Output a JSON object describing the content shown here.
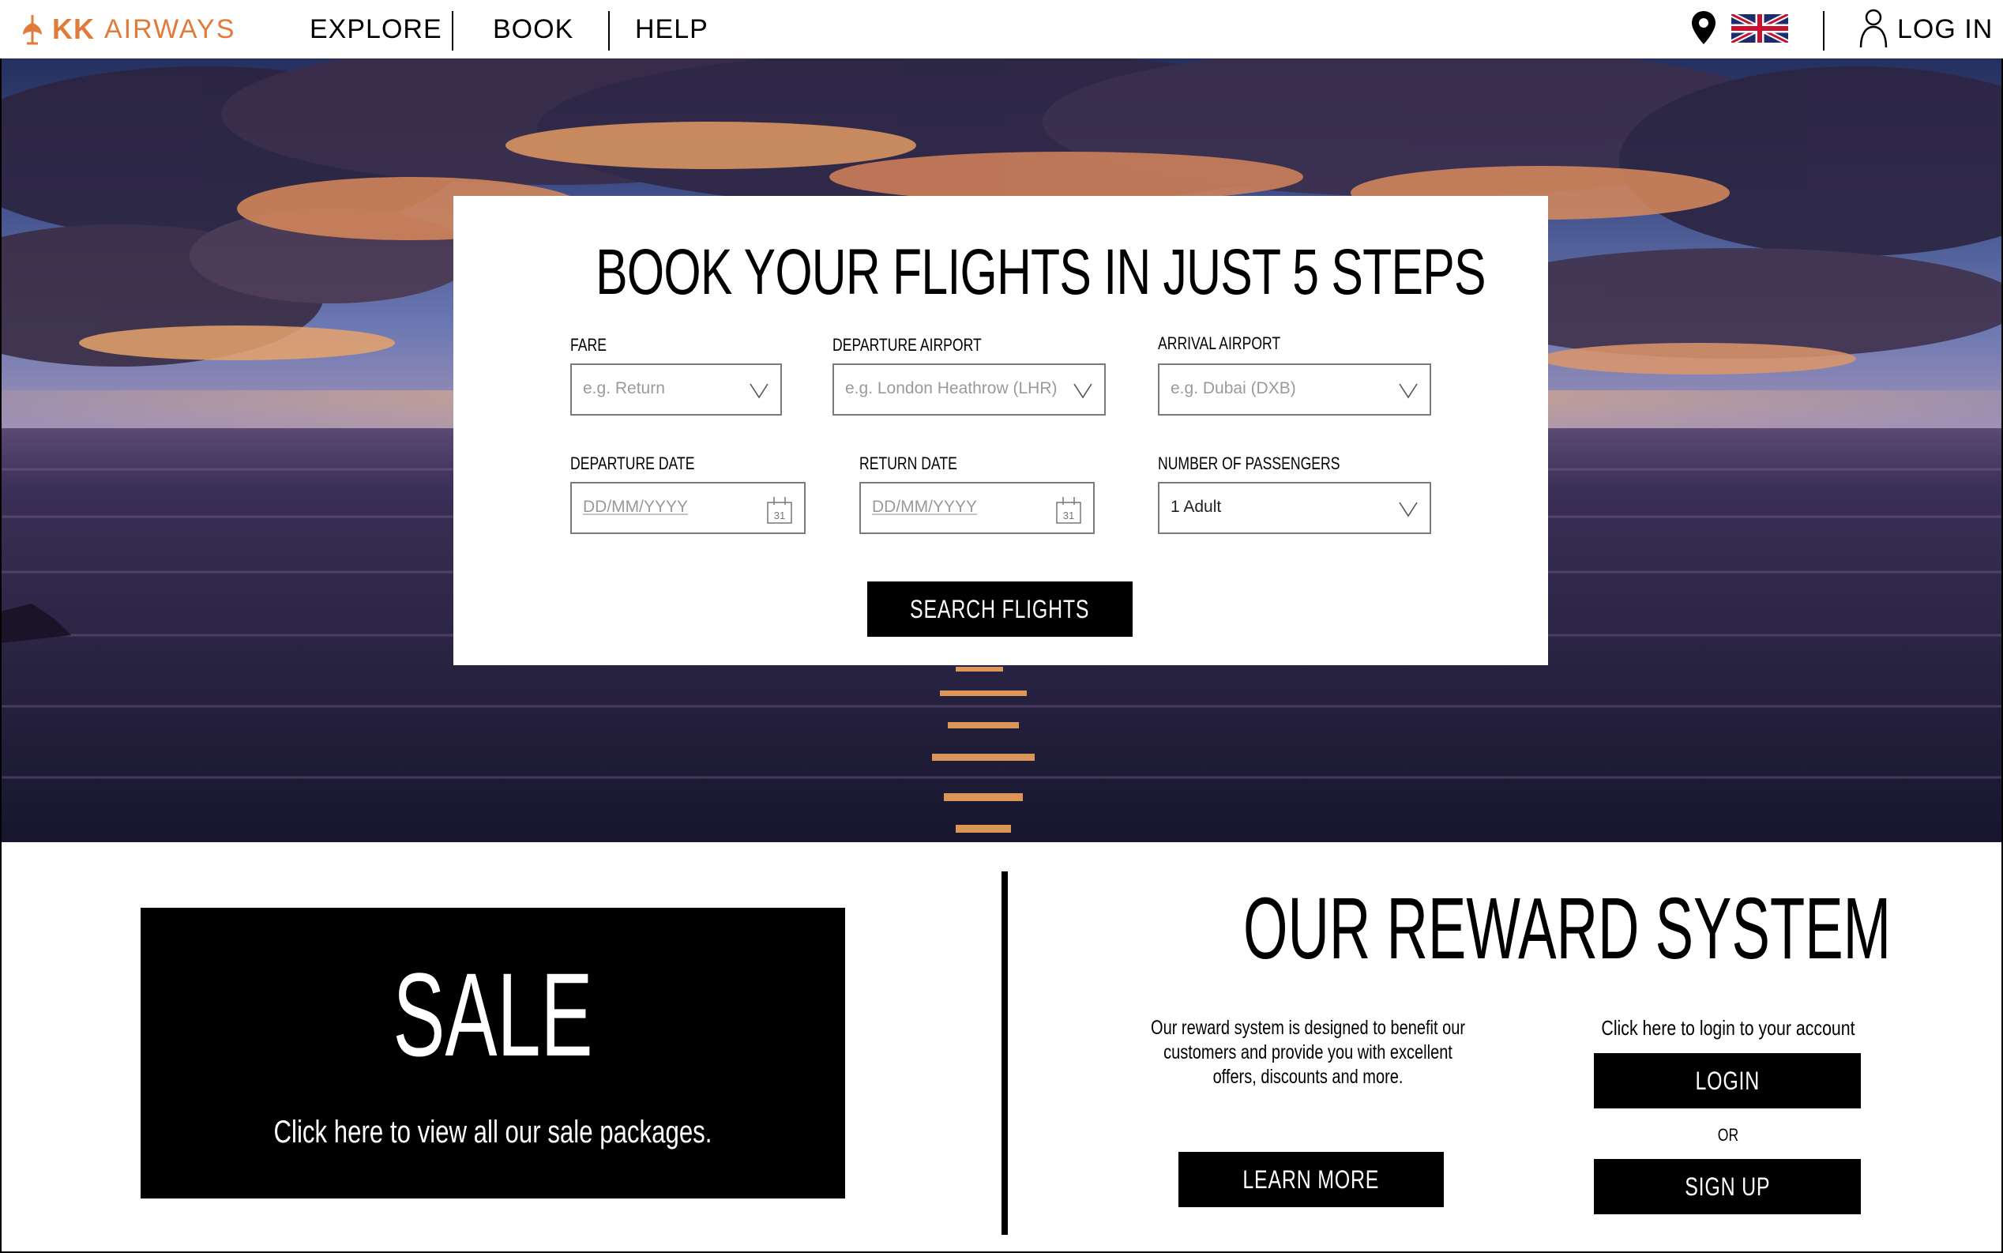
{
  "brand": {
    "kk": "KK",
    "name": "AIRWAYS",
    "color": "#e07b39"
  },
  "nav": {
    "links": [
      "EXPLORE",
      "BOOK",
      "HELP"
    ],
    "location_icon": "map-pin-icon",
    "language_icon": "uk-flag-icon",
    "user_icon": "user-icon",
    "login_label": "LOG IN"
  },
  "booking": {
    "title": "BOOK YOUR FLIGHTS IN JUST 5 STEPS",
    "fare": {
      "label": "FARE",
      "placeholder": "e.g. Return"
    },
    "departure_airport": {
      "label": "DEPARTURE AIRPORT",
      "placeholder": "e.g. London Heathrow (LHR)"
    },
    "arrival_airport": {
      "label": "ARRIVAL AIRPORT",
      "placeholder": "e.g. Dubai (DXB)"
    },
    "departure_date": {
      "label": "DEPARTURE DATE",
      "placeholder": "DD/MM/YYYY",
      "calendar_day": "31"
    },
    "return_date": {
      "label": "RETURN DATE",
      "placeholder": "DD/MM/YYYY",
      "calendar_day": "31"
    },
    "passengers": {
      "label": "NUMBER OF PASSENGERS",
      "value": "1 Adult"
    },
    "search_label": "SEARCH FLIGHTS"
  },
  "sale": {
    "title": "SALE",
    "subtitle": "Click here to view all our sale packages."
  },
  "rewards": {
    "title": "OUR REWARD SYSTEM",
    "description": "Our reward system is designed to benefit our customers and provide you with  excellent offers, discounts and more.",
    "learn_more_label": "LEARN MORE",
    "login_prompt": "Click here to login to your account",
    "login_label": "LOGIN",
    "or_label": "OR",
    "signup_label": "SIGN UP"
  }
}
